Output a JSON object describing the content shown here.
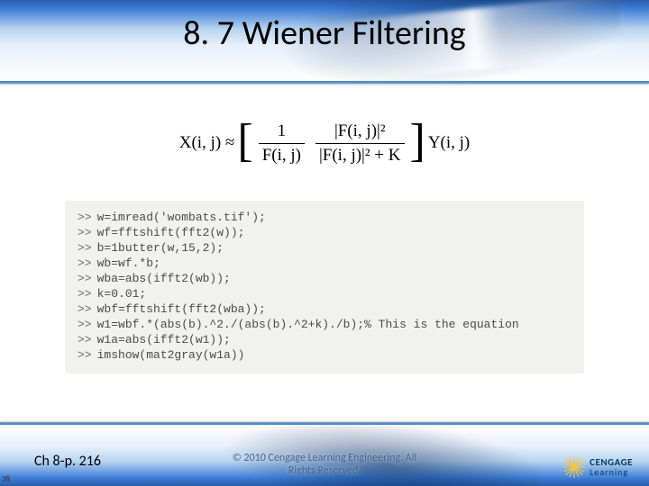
{
  "title": "8. 7 Wiener Filtering",
  "equation": {
    "lhs": "X(i, j) ≈",
    "frac1_num": "1",
    "frac1_den": "F(i, j)",
    "frac2_num": "|F(i, j)|²",
    "frac2_den": "|F(i, j)|² + K",
    "rhs": "Y(i, j)"
  },
  "code": {
    "prompt": ">>",
    "lines": [
      "w=imread('wombats.tif');",
      "wf=fftshift(fft2(w));",
      "b=1butter(w,15,2);",
      "wb=wf.*b;",
      "wba=abs(ifft2(wb));",
      "k=0.01;",
      "wbf=fftshift(fft2(wba));",
      "w1=wbf.*(abs(b).^2./(abs(b).^2+k)./b);% This is the equation",
      "w1a=abs(ifft2(w1));",
      "imshow(mat2gray(w1a))"
    ]
  },
  "footer": {
    "left": "Ch 8-p. 216",
    "center_line1": "© 2010 Cengage Learning Engineering. All",
    "center_line2": "Rights Reserved.",
    "logo_brand": "CENGAGE",
    "logo_sub": "Learning"
  },
  "page_number": "38"
}
